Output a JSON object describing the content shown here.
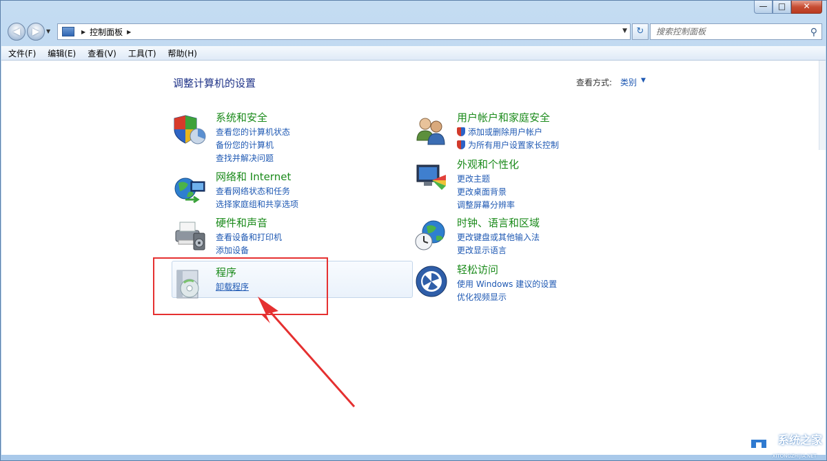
{
  "window": {
    "caption": {
      "minimize": "—",
      "maximize": "□",
      "close": "✕"
    }
  },
  "nav": {
    "back_glyph": "◀",
    "forward_glyph": "▶",
    "address_path": "控制面板",
    "search_placeholder": "搜索控制面板"
  },
  "menu": [
    "文件(F)",
    "编辑(E)",
    "查看(V)",
    "工具(T)",
    "帮助(H)"
  ],
  "content": {
    "heading": "调整计算机的设置",
    "view_by_label": "查看方式:",
    "view_by_value": "类别"
  },
  "categories": {
    "system": {
      "title": "系统和安全",
      "links": [
        "查看您的计算机状态",
        "备份您的计算机",
        "查找并解决问题"
      ]
    },
    "network": {
      "title": "网络和 Internet",
      "links": [
        "查看网络状态和任务",
        "选择家庭组和共享选项"
      ]
    },
    "hardware": {
      "title": "硬件和声音",
      "links": [
        "查看设备和打印机",
        "添加设备"
      ]
    },
    "programs": {
      "title": "程序",
      "links": [
        "卸载程序"
      ]
    },
    "users": {
      "title": "用户帐户和家庭安全",
      "links": [
        "添加或删除用户帐户",
        "为所有用户设置家长控制"
      ]
    },
    "appearance": {
      "title": "外观和个性化",
      "links": [
        "更改主题",
        "更改桌面背景",
        "调整屏幕分辨率"
      ]
    },
    "clock": {
      "title": "时钟、语言和区域",
      "links": [
        "更改键盘或其他输入法",
        "更改显示语言"
      ]
    },
    "ease": {
      "title": "轻松访问",
      "links": [
        "使用 Windows 建议的设置",
        "优化视频显示"
      ]
    }
  },
  "watermark": {
    "text": "系统之家",
    "sub": "XITONGZHIJIA.NET"
  },
  "colors": {
    "title_green": "#1a8a1a",
    "link_blue": "#1f59b3",
    "heading_blue": "#1e3287",
    "annotation_red": "#e53030"
  }
}
